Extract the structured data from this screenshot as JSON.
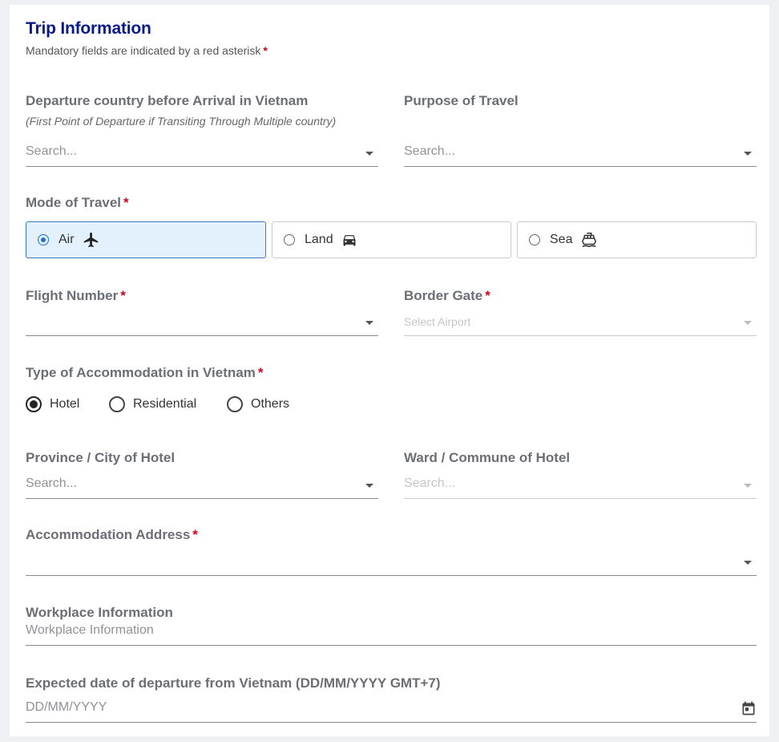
{
  "header": {
    "title": "Trip Information",
    "subtitle": "Mandatory fields are indicated by a red asterisk",
    "required_mark": "*"
  },
  "departure_country": {
    "label": "Departure country before Arrival in Vietnam",
    "hint": "(First Point of Departure if Transiting Through Multiple country)",
    "placeholder": "Search..."
  },
  "purpose": {
    "label": "Purpose of Travel",
    "placeholder": "Search..."
  },
  "mode_of_travel": {
    "label": "Mode of Travel",
    "options": [
      {
        "label": "Air",
        "icon": "airplane-icon",
        "selected": true
      },
      {
        "label": "Land",
        "icon": "car-icon",
        "selected": false
      },
      {
        "label": "Sea",
        "icon": "ship-icon",
        "selected": false
      }
    ]
  },
  "flight_number": {
    "label": "Flight Number",
    "value": ""
  },
  "border_gate": {
    "label": "Border Gate",
    "placeholder": "Select Airport"
  },
  "accommodation_type": {
    "label": "Type of Accommodation in Vietnam",
    "options": [
      {
        "label": "Hotel",
        "selected": true
      },
      {
        "label": "Residential",
        "selected": false
      },
      {
        "label": "Others",
        "selected": false
      }
    ]
  },
  "province": {
    "label": "Province / City of Hotel",
    "placeholder": "Search..."
  },
  "ward": {
    "label": "Ward / Commune of Hotel",
    "placeholder": "Search..."
  },
  "accommodation_address": {
    "label": "Accommodation Address",
    "value": ""
  },
  "workplace": {
    "label": "Workplace Information",
    "placeholder": "Workplace Information"
  },
  "departure_date": {
    "label": "Expected date of departure from Vietnam (DD/MM/YYYY GMT+7)",
    "placeholder": "DD/MM/YYYY"
  },
  "colors": {
    "title": "#0a1a8c",
    "required": "#d0021b",
    "selected_bg": "#e3f1fd",
    "selected_border": "#3a78c2"
  }
}
